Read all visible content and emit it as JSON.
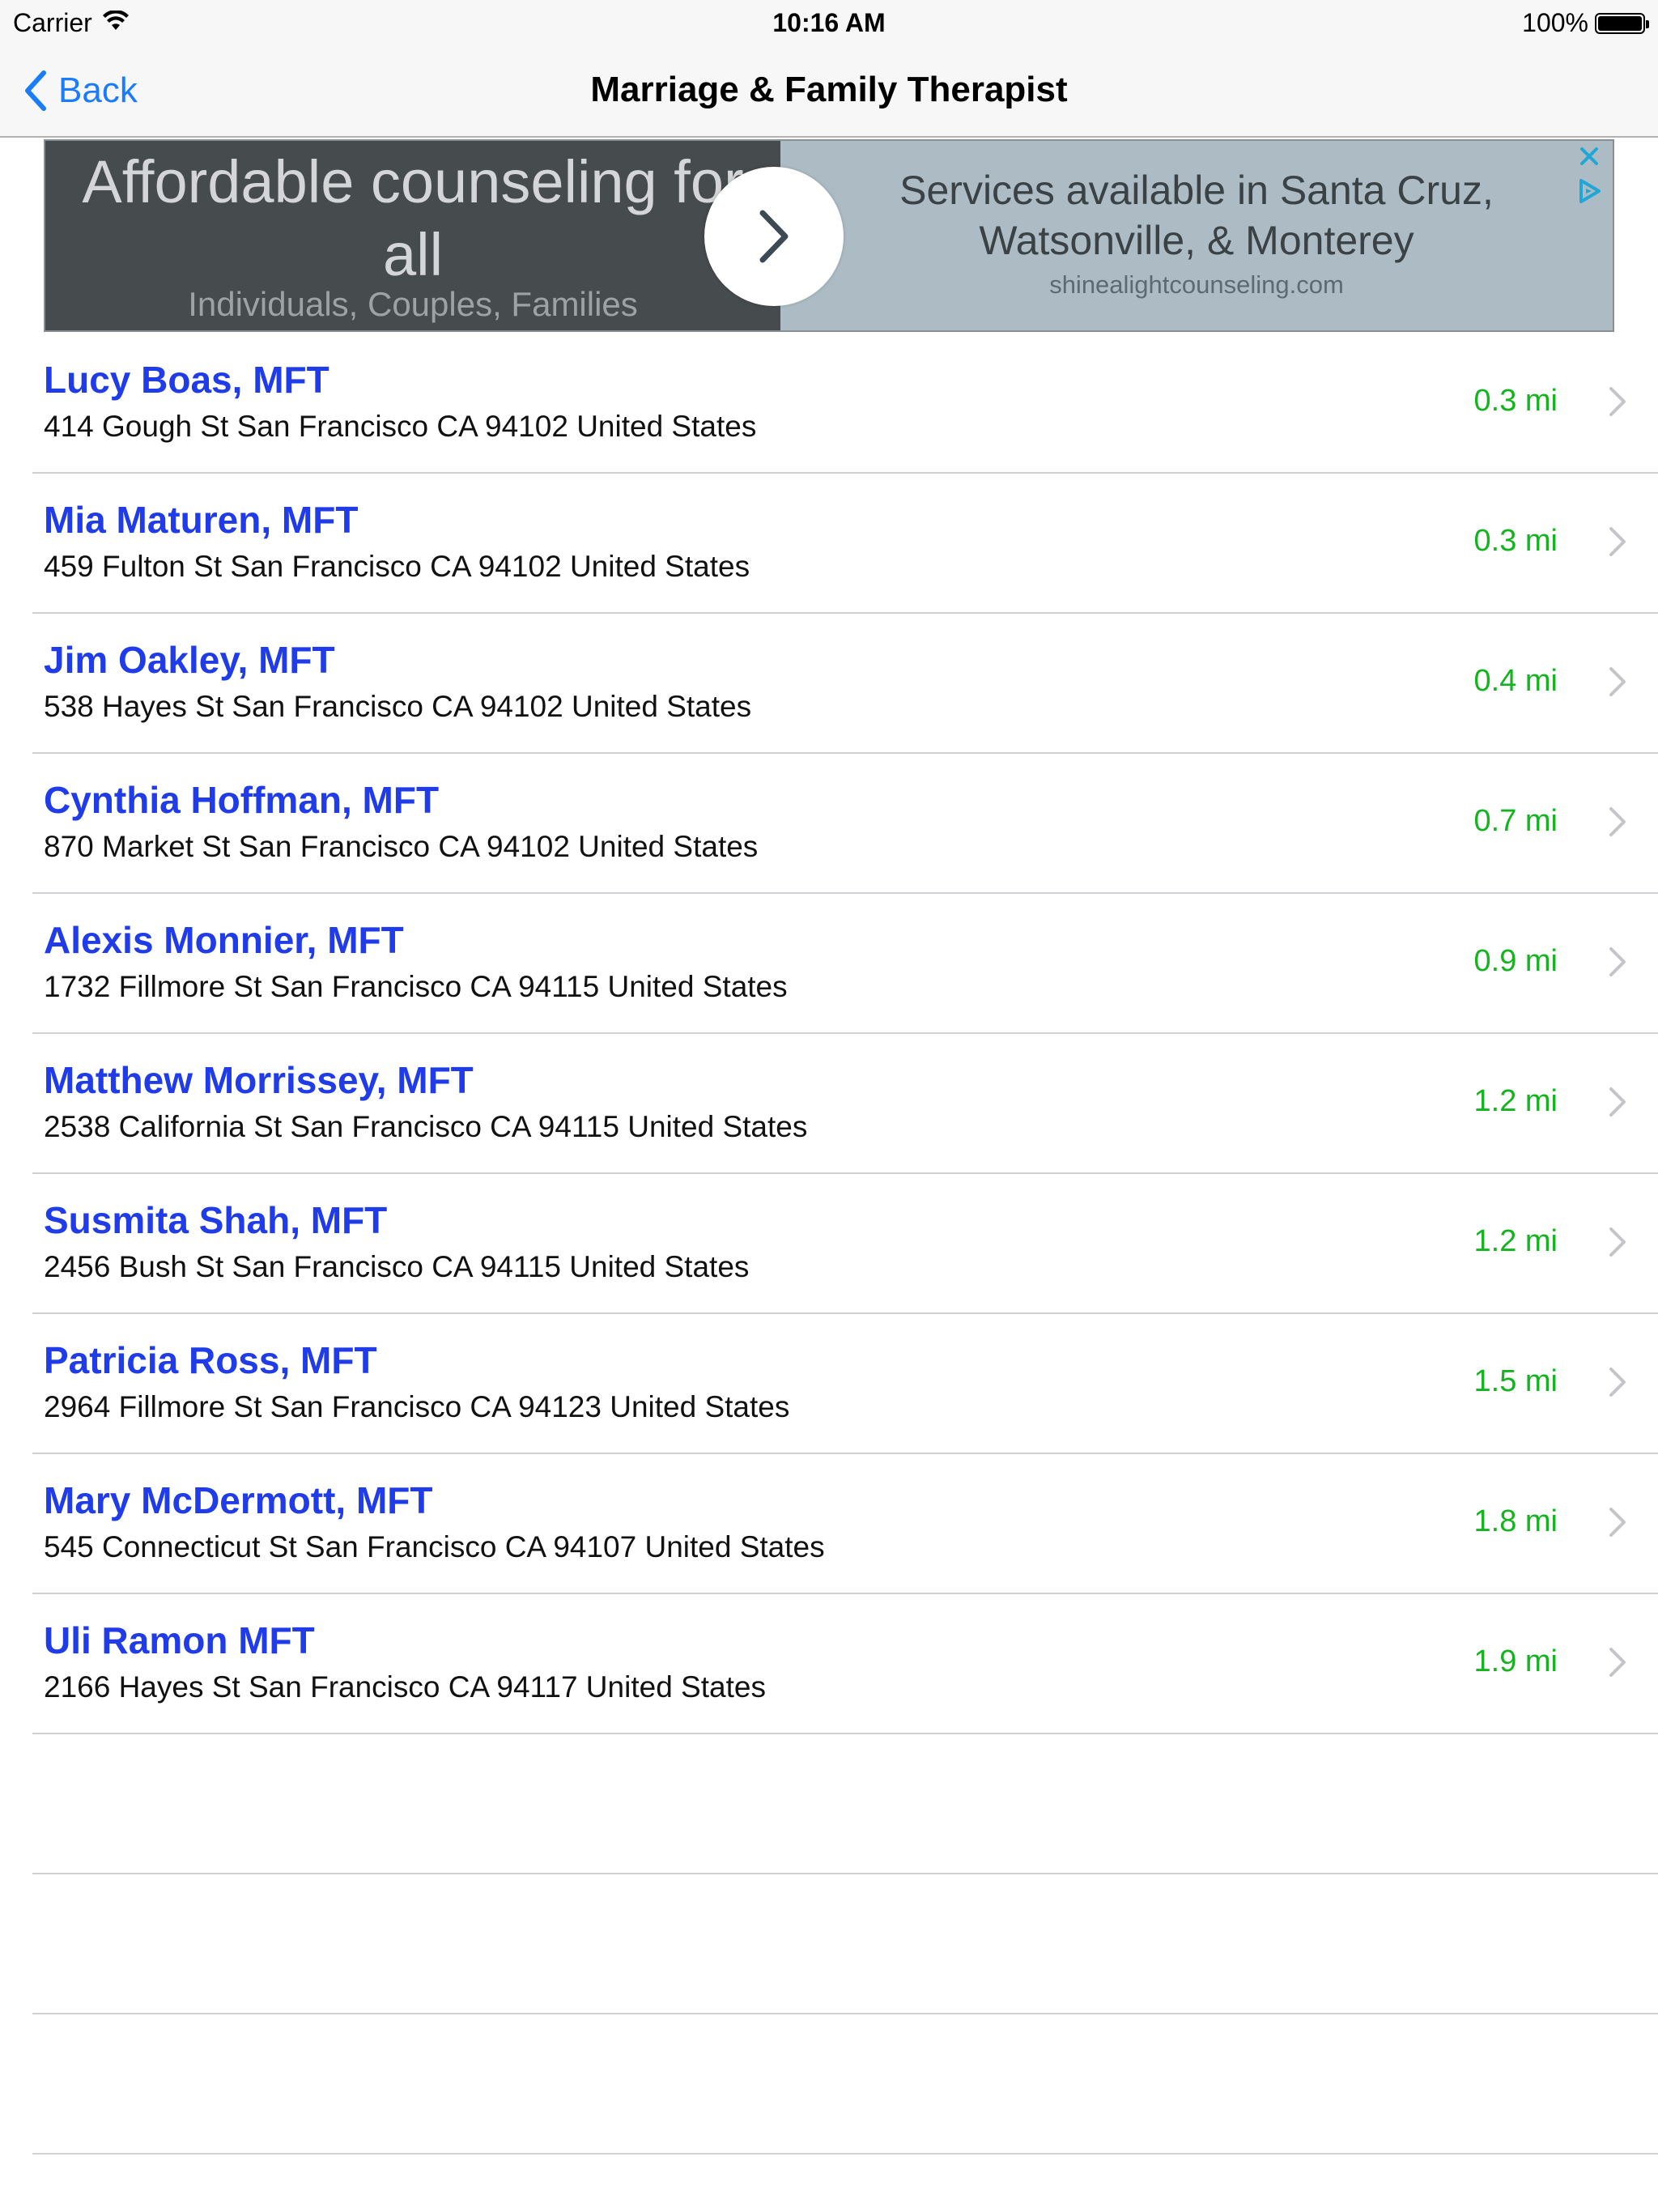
{
  "status_bar": {
    "carrier": "Carrier",
    "time": "10:16 AM",
    "battery": "100%"
  },
  "nav": {
    "back_label": "Back",
    "title": "Marriage & Family Therapist"
  },
  "ad": {
    "headline": "Affordable counseling for all",
    "subline": "Individuals, Couples, Families",
    "right_text": "Services available in Santa Cruz, Watsonville, & Monterey",
    "domain": "shinealightcounseling.com"
  },
  "therapists": [
    {
      "name": "Lucy Boas, MFT",
      "address": "414 Gough St San Francisco CA 94102 United States",
      "distance": "0.3 mi"
    },
    {
      "name": "Mia Maturen, MFT",
      "address": "459 Fulton St San Francisco CA 94102 United States",
      "distance": "0.3 mi"
    },
    {
      "name": "Jim Oakley, MFT",
      "address": "538 Hayes St San Francisco CA 94102 United States",
      "distance": "0.4 mi"
    },
    {
      "name": "Cynthia Hoffman, MFT",
      "address": "870 Market St San Francisco CA 94102 United States",
      "distance": "0.7 mi"
    },
    {
      "name": "Alexis Monnier, MFT",
      "address": "1732 Fillmore St San Francisco CA 94115 United States",
      "distance": "0.9 mi"
    },
    {
      "name": "Matthew Morrissey, MFT",
      "address": "2538 California St San Francisco CA 94115 United States",
      "distance": "1.2 mi"
    },
    {
      "name": "Susmita Shah, MFT",
      "address": "2456 Bush St San Francisco CA 94115 United States",
      "distance": "1.2 mi"
    },
    {
      "name": "Patricia Ross, MFT",
      "address": "2964 Fillmore St San Francisco CA 94123 United States",
      "distance": "1.5 mi"
    },
    {
      "name": "Mary McDermott, MFT",
      "address": "545 Connecticut St San Francisco CA 94107 United States",
      "distance": "1.8 mi"
    },
    {
      "name": "Uli Ramon MFT",
      "address": "2166 Hayes St San Francisco CA 94117 United States",
      "distance": "1.9 mi"
    }
  ],
  "colors": {
    "tint": "#1a7cfa",
    "name": "#1f3ce8",
    "distance": "#16b321"
  },
  "icons": {
    "wifi": "wifi-icon",
    "battery": "battery-icon",
    "back": "chevron-left-icon",
    "row_disclosure": "chevron-right-icon",
    "ad_arrow": "chevron-right-icon",
    "ad_close": "close-icon",
    "ad_choices": "adchoices-icon"
  }
}
